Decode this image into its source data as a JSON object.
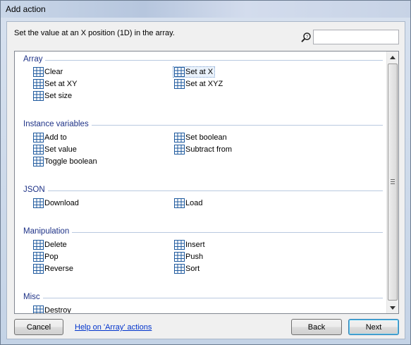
{
  "window": {
    "title": "Add action"
  },
  "description": "Set the value at an X position (1D) in the array.",
  "search": {
    "value": "",
    "placeholder": ""
  },
  "categories": [
    {
      "name": "Array",
      "actions": [
        "Clear",
        "Set at X",
        "Set at XY",
        "Set at XYZ",
        "Set size"
      ]
    },
    {
      "name": "Instance variables",
      "actions": [
        "Add to",
        "Set boolean",
        "Set value",
        "Subtract from",
        "Toggle boolean"
      ]
    },
    {
      "name": "JSON",
      "actions": [
        "Download",
        "Load"
      ]
    },
    {
      "name": "Manipulation",
      "actions": [
        "Delete",
        "Insert",
        "Pop",
        "Push",
        "Reverse",
        "Sort"
      ]
    },
    {
      "name": "Misc",
      "actions": [
        "Destroy"
      ]
    }
  ],
  "selected_action": "Set at X",
  "footer": {
    "cancel_label": "Cancel",
    "help_link": "Help on 'Array' actions",
    "back_label": "Back",
    "next_label": "Next"
  },
  "icons": {
    "action": "grid-icon",
    "search": "search-icon"
  },
  "colors": {
    "category_text": "#1e3287",
    "link": "#0033cc",
    "grid_icon": "#1f5a9e"
  }
}
